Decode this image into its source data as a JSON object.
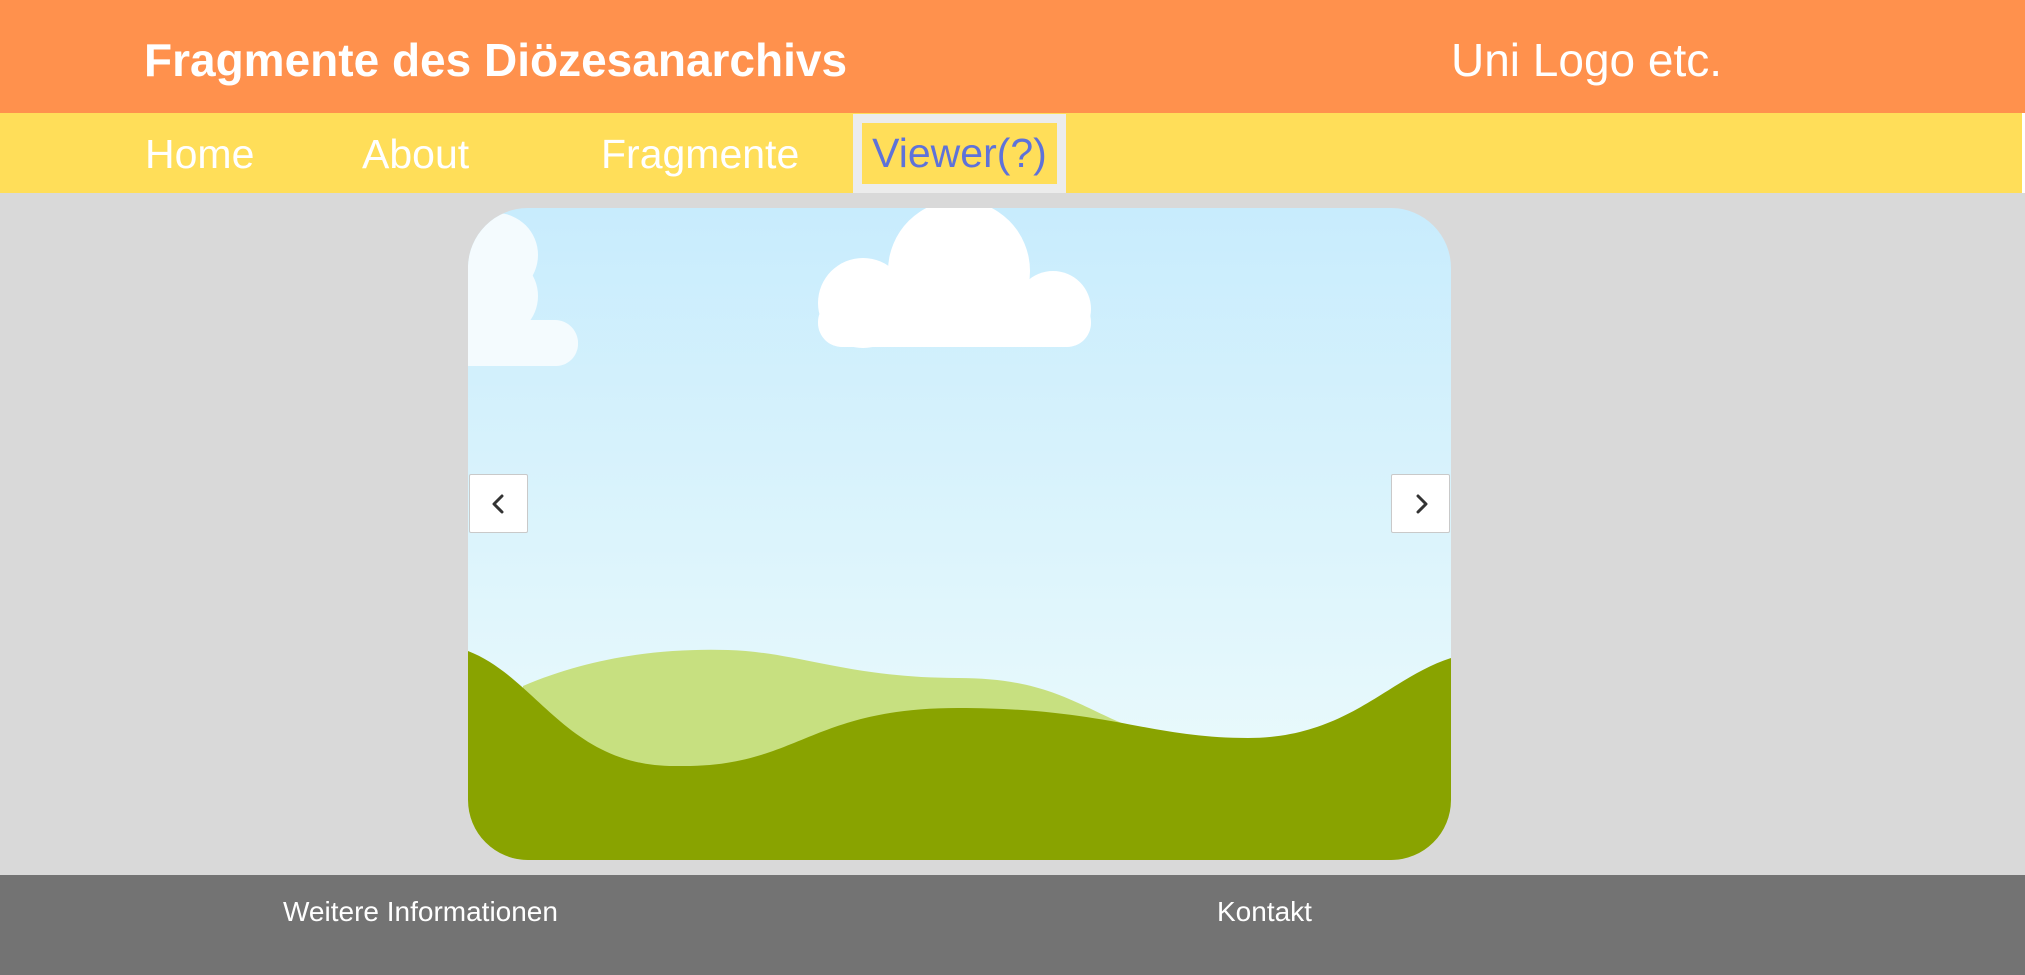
{
  "header": {
    "title": "Fragmente des Diözesanarchivs",
    "logo_text": "Uni Logo etc."
  },
  "nav": {
    "items": [
      {
        "label": "Home"
      },
      {
        "label": "About"
      },
      {
        "label": "Fragmente"
      },
      {
        "label": "Viewer(?)",
        "active": true
      }
    ]
  },
  "viewer": {
    "image_icon": "landscape-placeholder-image",
    "prev_icon": "chevron-left-icon",
    "next_icon": "chevron-right-icon"
  },
  "footer": {
    "links": [
      {
        "label": "Weitere Informationen"
      },
      {
        "label": "Kontakt"
      }
    ]
  },
  "colors": {
    "header_bg": "#ff914d",
    "nav_bg": "#ffde59",
    "active_nav_text": "#5e72d9",
    "page_bg": "#d9d9d9",
    "footer_bg": "#737373",
    "hill_dark": "#89a300",
    "hill_light": "#c7e080"
  }
}
